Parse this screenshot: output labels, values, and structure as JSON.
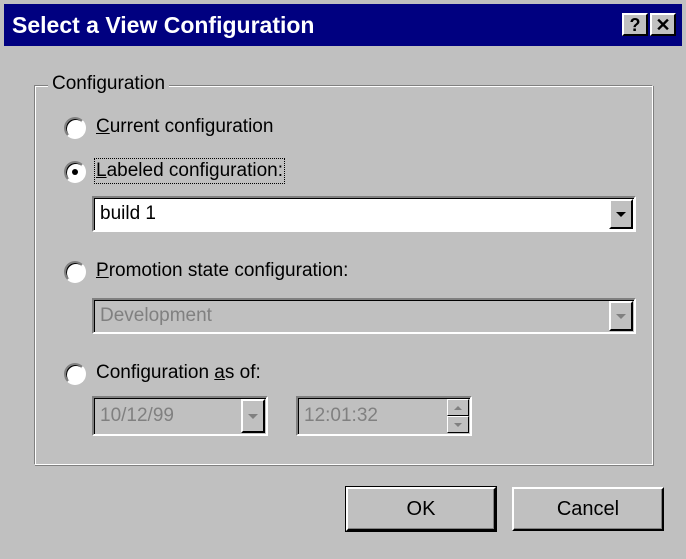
{
  "window": {
    "title": "Select a View Configuration",
    "help_glyph": "?",
    "close_glyph": "✕"
  },
  "group": {
    "label": "Configuration"
  },
  "options": {
    "current": {
      "label_prefix": "",
      "mnemonic": "C",
      "label_rest": "urrent configuration",
      "selected": false
    },
    "labeled": {
      "label_prefix": "",
      "mnemonic": "L",
      "label_rest": "abeled configuration:",
      "selected": true,
      "value": "build 1"
    },
    "promotion": {
      "label_prefix": "",
      "mnemonic": "P",
      "label_rest": "romotion state configuration:",
      "selected": false,
      "value": "Development"
    },
    "asof": {
      "label_prefix": "Configuration ",
      "mnemonic": "a",
      "label_rest": "s of:",
      "selected": false,
      "date": "10/12/99",
      "time": "12:01:32"
    }
  },
  "buttons": {
    "ok": "OK",
    "cancel": "Cancel"
  },
  "icons": {
    "help": "help-icon",
    "close": "close-icon",
    "dropdown": "chevron-down-icon",
    "spin_up": "spin-up-icon",
    "spin_down": "spin-down-icon"
  },
  "colors": {
    "titlebar": "#000080",
    "face": "#c0c0c0",
    "disabled_text": "#808080"
  }
}
